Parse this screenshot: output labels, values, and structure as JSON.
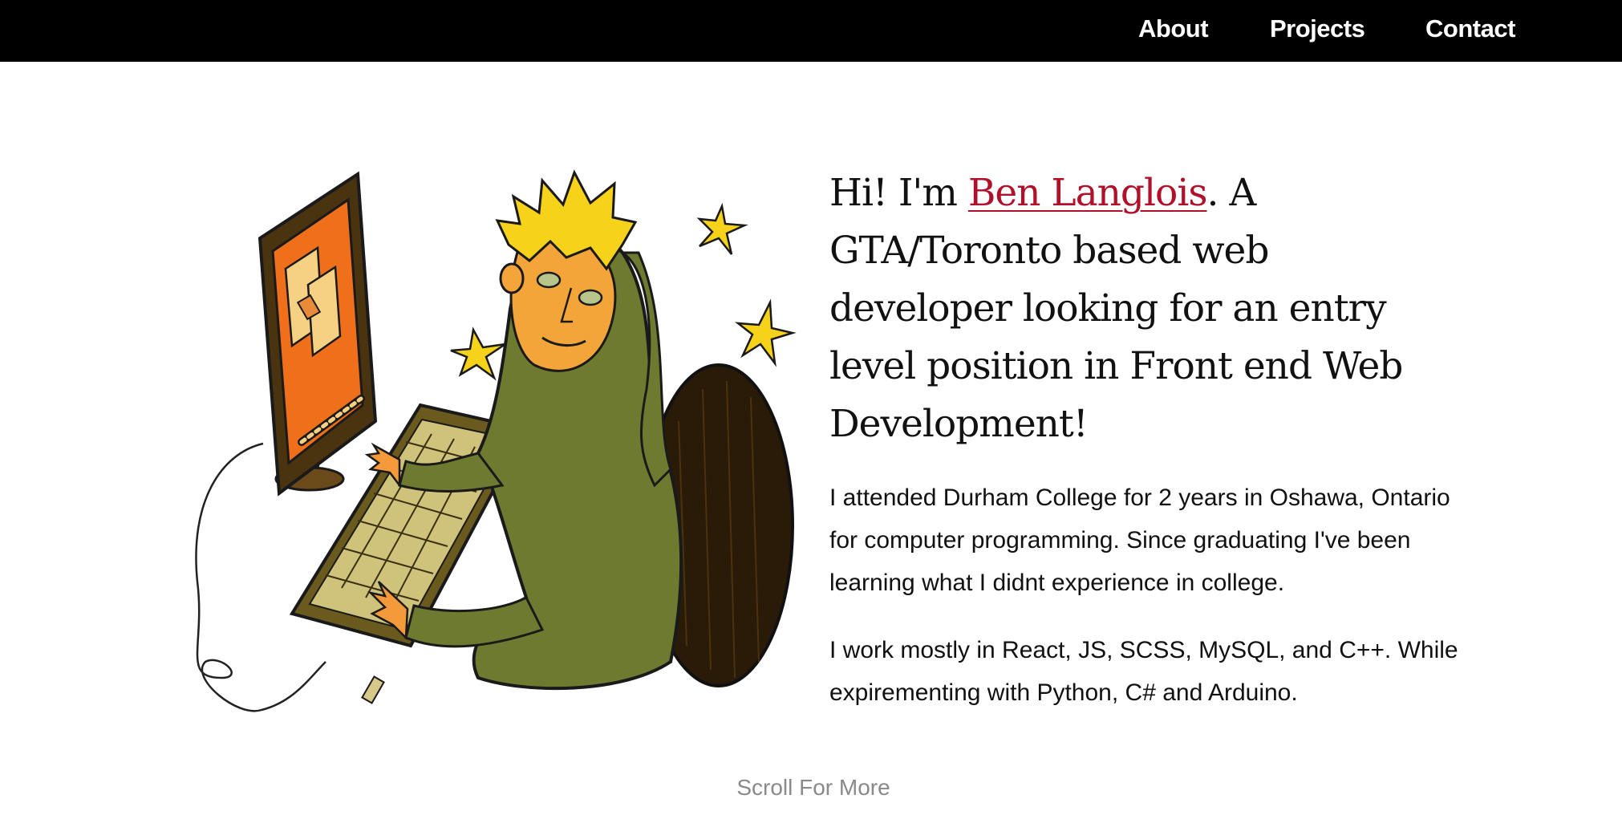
{
  "nav": {
    "items": [
      {
        "label": "About"
      },
      {
        "label": "Projects"
      },
      {
        "label": "Contact"
      }
    ]
  },
  "hero": {
    "greeting": "Hi! I'm ",
    "name": "Ben Langlois",
    "tagline": ". A GTA/Toronto based web developer looking for an entry level position in Front end Web Development!",
    "illustration_icon": "developer-at-computer-illustration"
  },
  "bio": {
    "paragraph_1": "I attended Durham College for 2 years in Oshawa, Ontario for computer programming. Since graduating I've been learning what I didnt experience in college.",
    "paragraph_2": "I work mostly in React, JS, SCSS, MySQL, and C++. While expirementing with Python, C# and Arduino."
  },
  "scroll_hint": "Scroll For More",
  "colors": {
    "nav_bg": "#000000",
    "accent_name": "#b0102a",
    "text": "#111111",
    "muted": "#8a8a8a"
  }
}
